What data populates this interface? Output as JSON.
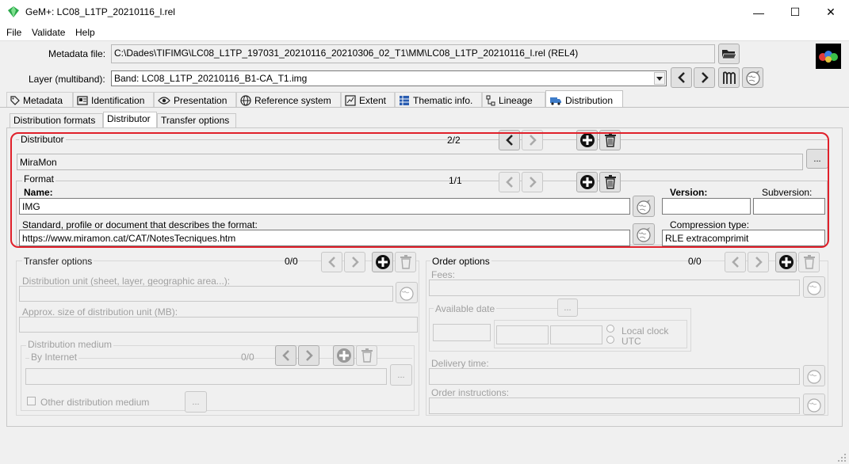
{
  "window": {
    "title": "GeM+: LC08_L1TP_20210116_l.rel",
    "controls": {
      "minimize": "—",
      "maximize": "☐",
      "close": "✕"
    }
  },
  "menu": {
    "file": "File",
    "validate": "Validate",
    "help": "Help"
  },
  "metadata_file": {
    "label": "Metadata file:",
    "value": "C:\\Dades\\TIFIMG\\LC08_L1TP_197031_20210116_20210306_02_T1\\MM\\LC08_L1TP_20210116_l.rel (REL4)"
  },
  "layer": {
    "label": "Layer (multiband):",
    "value": "Band: LC08_L1TP_20210116_B1-CA_T1.img"
  },
  "main_tabs": [
    "Metadata",
    "Identification",
    "Presentation",
    "Reference system",
    "Extent",
    "Thematic info.",
    "Lineage",
    "Distribution"
  ],
  "sub_tabs": [
    "Distribution formats",
    "Distributor",
    "Transfer options"
  ],
  "distributor": {
    "title": "Distributor",
    "counter": "2/2",
    "value": "MiraMon",
    "ellipsis": "..."
  },
  "format": {
    "title": "Format",
    "counter": "1/1",
    "name_label": "Name:",
    "name_value": "IMG",
    "version_label": "Version:",
    "version_value": "",
    "subversion_label": "Subversion:",
    "subversion_value": "",
    "standard_label": "Standard, profile or document that describes the format:",
    "standard_value": "https://www.miramon.cat/CAT/NotesTecniques.htm",
    "compression_label": "Compression type:",
    "compression_value": "RLE extracomprimit"
  },
  "transfer_options": {
    "title": "Transfer options",
    "counter": "0/0",
    "unit_label": "Distribution unit (sheet, layer, geographic area...):",
    "size_label": "Approx. size of distribution unit (MB):",
    "medium_title": "Distribution medium",
    "internet_title": "By Internet",
    "internet_counter": "0/0",
    "internet_ellipsis": "...",
    "other_label": "Other distribution medium",
    "other_ellipsis": "..."
  },
  "order_options": {
    "title": "Order options",
    "counter": "0/0",
    "fees_label": "Fees:",
    "available_label": "Available date",
    "available_ellipsis": "...",
    "local_clock": "Local clock",
    "utc": "UTC",
    "delivery_label": "Delivery time:",
    "instructions_label": "Order instructions:"
  }
}
